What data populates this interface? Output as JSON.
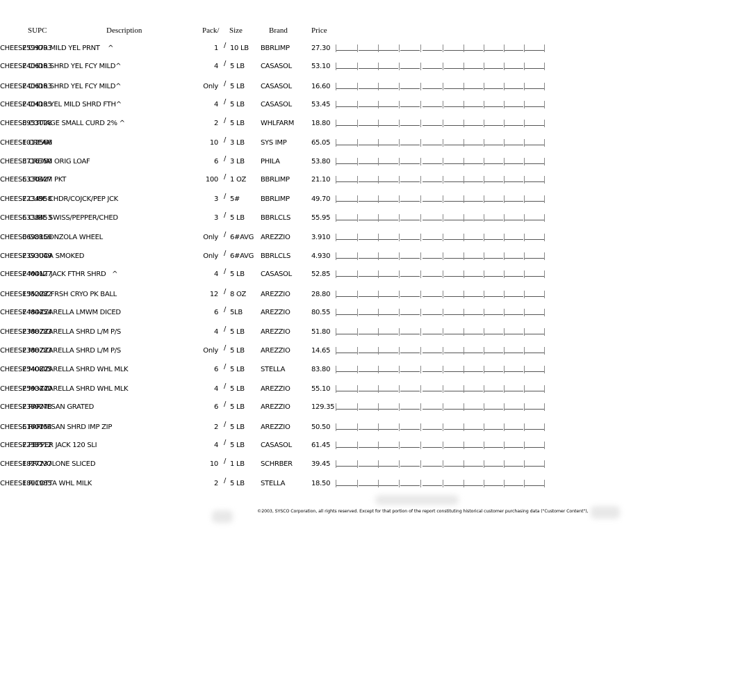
{
  "headers": {
    "supc": "SUPC",
    "description": "Description",
    "pack": "Pack/",
    "size": "Size",
    "brand": "Brand",
    "price": "Price"
  },
  "rows": [
    {
      "supc": "2599793",
      "description": "CHEESE CHDR MILD YEL PRNT    ^",
      "pack": "1",
      "size": "10 LB",
      "brand": "BBRLIMP",
      "price": "27.30"
    },
    {
      "supc": "2406163",
      "description": "CHEESE CHDR SHRD YEL FCY MILD^",
      "pack": "4",
      "size": "5 LB",
      "brand": "CASASOL",
      "price": "53.10"
    },
    {
      "supc": "2406163",
      "description": "CHEESE CHDR SHRD YEL FCY MILD^",
      "pack": "Only",
      "size": "5 LB",
      "brand": "CASASOL",
      "price": "16.60"
    },
    {
      "supc": "2404135",
      "description": "CHEESE CHDR YEL MILD SHRD FTH^",
      "pack": "4",
      "size": "5 LB",
      "brand": "CASASOL",
      "price": "53.45"
    },
    {
      "supc": "8953028",
      "description": "CHEESE COTTAGE SMALL CURD 2% ^",
      "pack": "2",
      "size": "5 LB",
      "brand": "WHLFARM",
      "price": "18.80"
    },
    {
      "supc": "1012566",
      "description": "CHEESE CREAM",
      "pack": "10",
      "size": "3 LB",
      "brand": "SYS IMP",
      "price": "65.05"
    },
    {
      "supc": "3716750",
      "description": "CHEESE CREAM ORIG LOAF",
      "pack": "6",
      "size": "3 LB",
      "brand": "PHILA",
      "price": "53.80"
    },
    {
      "supc": "6330427",
      "description": "CHEESE CREAM PKT",
      "pack": "100",
      "size": "1 OZ",
      "brand": "BBRLIMP",
      "price": "21.10"
    },
    {
      "supc": "7234958",
      "description": "CHEESE CUBE CHDR/COJCK/PEP JCK",
      "pack": "3",
      "size": "5#",
      "brand": "BBRLIMP",
      "price": "49.70"
    },
    {
      "supc": "6338453",
      "description": "CHEESE CUBE SWISS/PEPPER/CHED",
      "pack": "3",
      "size": "5 LB",
      "brand": "BBRLCLS",
      "price": "55.95"
    },
    {
      "supc": "0698159",
      "description": "CHEESE GORGONZOLA WHEEL",
      "pack": "Only",
      "size": "6#AVG",
      "brand": "AREZZIO",
      "price": "3.910"
    },
    {
      "supc": "2393049",
      "description": "CHEESE GOUDA SMOKED",
      "pack": "Only",
      "size": "6#AVG",
      "brand": "BBRLCLS",
      "price": "4.930"
    },
    {
      "supc": "2404127",
      "description": "CHEESE MONT JACK FTHR SHRD   ^",
      "pack": "4",
      "size": "5 LB",
      "brand": "CASASOL",
      "price": "52.85"
    },
    {
      "supc": "1552082",
      "description": "CHEESE MOZZ FRSH CRYO PK BALL",
      "pack": "12",
      "size": "8 OZ",
      "brand": "AREZZIO",
      "price": "28.80"
    },
    {
      "supc": "7484454",
      "description": "CHEESE MOZZARELLA LMWM DICED",
      "pack": "6",
      "size": "5LB",
      "brand": "AREZZIO",
      "price": "80.55"
    },
    {
      "supc": "2388783",
      "description": "CHEESE MOZZARELLA SHRD L/M P/S",
      "pack": "4",
      "size": "5 LB",
      "brand": "AREZZIO",
      "price": "51.80"
    },
    {
      "supc": "2388783",
      "description": "CHEESE MOZZARELLA SHRD L/M P/S",
      "pack": "Only",
      "size": "5 LB",
      "brand": "AREZZIO",
      "price": "14.65"
    },
    {
      "supc": "2540805",
      "description": "CHEESE MOZZARELLA SHRD WHL MLK",
      "pack": "6",
      "size": "5 LB",
      "brand": "STELLA",
      "price": "83.80"
    },
    {
      "supc": "2593440",
      "description": "CHEESE MOZZARELLA SHRD WHL MLK",
      "pack": "4",
      "size": "5 LB",
      "brand": "AREZZIO",
      "price": "55.10"
    },
    {
      "supc": "2389278",
      "description": "CHEESE PARMESAN GRATED",
      "pack": "6",
      "size": "5 LB",
      "brand": "AREZZIO",
      "price": "129.35"
    },
    {
      "supc": "6160154",
      "description": "CHEESE PARMESAN SHRD IMP ZIP",
      "pack": "2",
      "size": "5 LB",
      "brand": "AREZZIO",
      "price": "50.50"
    },
    {
      "supc": "7238512",
      "description": "CHEESE PEPPER JACK 120 SLI",
      "pack": "4",
      "size": "5 LB",
      "brand": "CASASOL",
      "price": "61.45"
    },
    {
      "supc": "1827237",
      "description": "CHEESE PROVOLONE SLICED",
      "pack": "10",
      "size": "1 LB",
      "brand": "SCHRBER",
      "price": "39.45"
    },
    {
      "supc": "1891985",
      "description": "CHEESE RICOTTA WHL MILK",
      "pack": "2",
      "size": "5 LB",
      "brand": "STELLA",
      "price": "18.50"
    }
  ],
  "pack_separator": "/",
  "footer": {
    "copyright": "©2003, SYSCO Corporation, all rights reserved.  Except for that portion of the report constituting historical customer purchasing data (\"Customer Content\"),"
  }
}
